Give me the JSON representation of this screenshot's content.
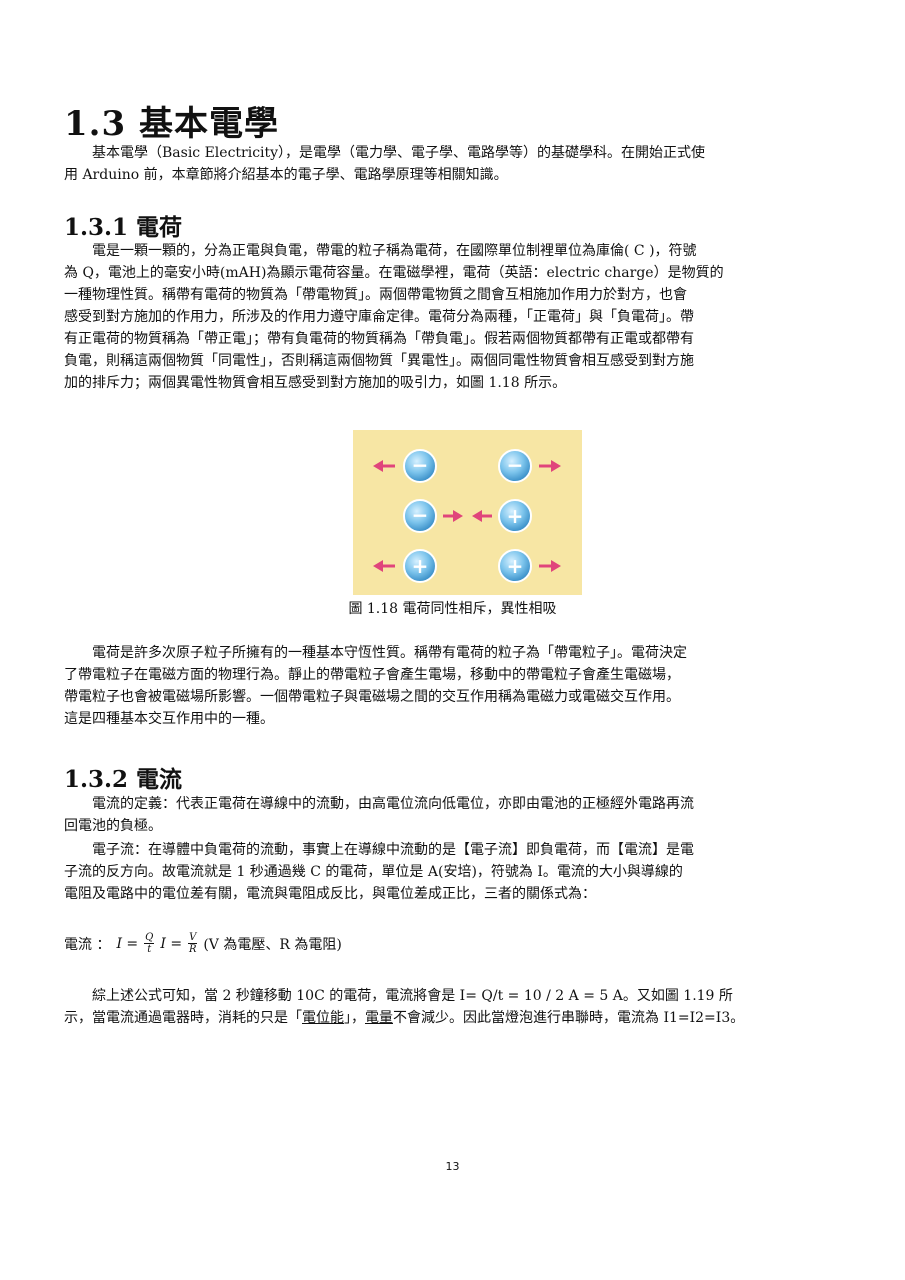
{
  "section": {
    "title": "1.3  基本電學",
    "intro": [
      "基本電學（Basic Electricity），是電學（電力學、電子學、電路學等）的基礎學科。在開始正式使",
      "用 Arduino 前，本章節將介紹基本的電子學、電路學原理等相關知識。"
    ]
  },
  "charge": {
    "title": "1.3.1 電荷",
    "para1": [
      "電是一顆一顆的，分為正電與負電，帶電的粒子稱為電荷，在國際單位制裡單位為庫倫( C )，符號",
      "為 Q，電池上的毫安小時(mAH)為顯示電荷容量。在電磁學裡，電荷（英語：electric charge）是物質的",
      "一種物理性質。稱帶有電荷的物質為「帶電物質」。兩個帶電物質之間會互相施加作用力於對方，也會",
      "感受到對方施加的作用力，所涉及的作用力遵守庫侖定律。電荷分為兩種，「正電荷」與「負電荷」。帶",
      "有正電荷的物質稱為「帶正電」；帶有負電荷的物質稱為「帶負電」。假若兩個物質都帶有正電或都帶有",
      "負電，則稱這兩個物質「同電性」，否則稱這兩個物質「異電性」。兩個同電性物質會相互感受到對方施",
      "加的排斥力；兩個異電性物質會相互感受到對方施加的吸引力，如圖 1.18 所示。"
    ],
    "figure_caption": "圖 1.18 電荷同性相斥，異性相吸",
    "figure_symbols": {
      "negative": "−",
      "positive": "+"
    },
    "figure_colors": {
      "background": "#f7e6a4",
      "charge": "#5aaee0",
      "arrow": "#e0457b"
    },
    "para2": [
      "電荷是許多次原子粒子所擁有的一種基本守恆性質。稱帶有電荷的粒子為「帶電粒子」。電荷決定",
      "了帶電粒子在電磁方面的物理行為。靜止的帶電粒子會產生電場，移動中的帶電粒子會產生電磁場，",
      "帶電粒子也會被電磁場所影響。一個帶電粒子與電磁場之間的交互作用稱為電磁力或電磁交互作用。",
      "這是四種基本交互作用中的一種。"
    ]
  },
  "current": {
    "title": "1.3.2 電流",
    "para1": [
      "電流的定義：代表正電荷在導線中的流動，由高電位流向低電位，亦即由電池的正極經外電路再流",
      "回電池的負極。"
    ],
    "para2": [
      "電子流：在導體中負電荷的流動，事實上在導線中流動的是【電子流】即負電荷，而【電流】是電",
      "子流的反方向。故電流就是 1 秒通過幾 C 的電荷，單位是 A(安培)，符號為 I。電流的大小與導線的",
      "電阻及電路中的電位差有關，電流與電阻成反比，與電位差成正比，三者的關係式為："
    ],
    "formula": {
      "label": "電流 ：",
      "lhs1": "I =",
      "num1": "Q",
      "den1": "t",
      "lhs2": "I =",
      "num2": "V",
      "den2": "R",
      "note": "(V 為電壓、R 為電阻)"
    },
    "para3_line1": "綜上述公式可知，當 2 秒鐘移動 10C 的電荷，電流將會是 I= Q/t = 10 / 2 A = 5 A。又如圖 1.19 所",
    "para3_line2": {
      "a": "示，當電流通過電器時，消耗的只是「",
      "b": "電位能",
      "c": "」，",
      "d": "電量",
      "e": "不會減少。因此當燈泡進行串聯時，電流為 I1=I2=I3。"
    }
  },
  "page_number": "13"
}
